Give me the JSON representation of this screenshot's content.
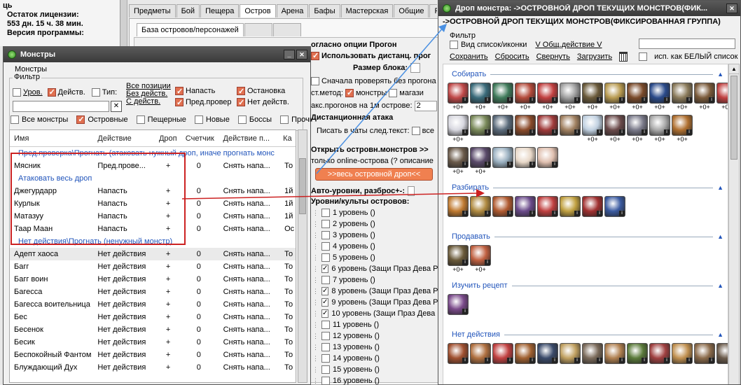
{
  "bg_window": {
    "license_label": "Остаток лицензии:",
    "license_value": "553 дн. 15 ч. 38 мин.",
    "version_label": "Версия программы:",
    "left_snippet": "ць",
    "tabs": [
      "Предметы",
      "Бой",
      "Пещера",
      "Остров",
      "Арена",
      "Бафы",
      "Мастерская",
      "Общие",
      "Раз"
    ],
    "subtab": "База островов/персонажей",
    "option_header": "огласно опции Прогон",
    "use_distant": "Использовать дистанц. прог",
    "block_size": "Размер блока:",
    "check_first": "Сначала проверять без прогона",
    "method_label": "ст.метод:",
    "method_monsters": "монстры",
    "method_magaz": "магази",
    "max_runs": "акс.прогонов на 1м острове:",
    "max_runs_value": "2",
    "distant_attack": "Дистанционная атака",
    "write_chats": "Писать в чаты след.текст:",
    "write_chats_opt": "все",
    "open_island": "Открыть островн.монстров >>",
    "online_only": "только online-острова (? описание",
    "all_drop_btn": ">>весь островной дроп<<",
    "auto_levels": "Авто-уровни, разброс+-:",
    "levels_header": "Уровни/культы островов:",
    "levels": [
      {
        "label": "1 уровень ()",
        "checked": false
      },
      {
        "label": "2 уровень ()",
        "checked": false
      },
      {
        "label": "3 уровень ()",
        "checked": false
      },
      {
        "label": "4 уровень ()",
        "checked": false
      },
      {
        "label": "5 уровень ()",
        "checked": false
      },
      {
        "label": "6 уровень (Защи Праз Дева Р",
        "checked": true
      },
      {
        "label": "7 уровень ()",
        "checked": false
      },
      {
        "label": "8 уровень (Защи Праз Дева Р",
        "checked": true
      },
      {
        "label": "9 уровень (Защи Праз Дева Р",
        "checked": true
      },
      {
        "label": "10 уровень (Защи Праз Дева Р",
        "checked": true
      },
      {
        "label": "11 уровень ()",
        "checked": false
      },
      {
        "label": "12 уровень ()",
        "checked": false
      },
      {
        "label": "13 уровень ()",
        "checked": false
      },
      {
        "label": "14 уровень ()",
        "checked": false
      },
      {
        "label": "15 уровень ()",
        "checked": false
      },
      {
        "label": "16 уровень ()",
        "checked": false
      }
    ]
  },
  "monsters_window": {
    "title": "Монстры",
    "group_monsters": "Монстры",
    "filter_label": "Фильтр",
    "chk_level": "Уров.",
    "chk_action": "Действ.",
    "chk_type": "Тип:",
    "link_all_pos": "Все позиции",
    "link_no_action": "Без действ.",
    "link_with_action": "С действ.",
    "chk_attack": "Напасть",
    "chk_precheck": "Пред.провер",
    "chk_stop": "Остановка",
    "chk_no_action": "Нет действ.",
    "clear_btn": "✕",
    "chk_all": "Все монстры",
    "chk_island": "Островные",
    "chk_cave": "Пещерные",
    "chk_new": "Новые",
    "chk_bosses": "Боссы",
    "chk_other": "Прочие",
    "columns": [
      "Имя",
      "Действие",
      "Дроп",
      "Счетчик",
      "Действие п...",
      "Ка"
    ],
    "groups": [
      {
        "title": "Пред.проверка\\Прогнать (атаковать нужный дроп, иначе прогнать монс",
        "rows": [
          [
            "Мясник",
            "Пред.прове...",
            "+",
            "0",
            "Снять напа...",
            "То"
          ]
        ]
      },
      {
        "title": "Атаковать весь дроп",
        "rows": [
          [
            "Джегурдарр",
            "Напасть",
            "+",
            "0",
            "Снять напа...",
            "1й"
          ],
          [
            "Курлык",
            "Напасть",
            "+",
            "0",
            "Снять напа...",
            "1й"
          ],
          [
            "Матазуу",
            "Напасть",
            "+",
            "0",
            "Снять напа...",
            "1й"
          ],
          [
            "Таар Маан",
            "Напасть",
            "+",
            "0",
            "Снять напа...",
            "Ос"
          ]
        ]
      },
      {
        "title": "Нет действия\\Прогнать (ненужный монстр)",
        "rows": [
          [
            "Адепт хаоса",
            "Нет действия",
            "+",
            "0",
            "Снять напа...",
            "То"
          ],
          [
            "Багг",
            "Нет действия",
            "+",
            "0",
            "Снять напа...",
            "То"
          ],
          [
            "Багг воин",
            "Нет действия",
            "+",
            "0",
            "Снять напа...",
            "То"
          ],
          [
            "Багесса",
            "Нет действия",
            "+",
            "0",
            "Снять напа...",
            "То"
          ],
          [
            "Багесса воительница",
            "Нет действия",
            "+",
            "0",
            "Снять напа...",
            "То"
          ],
          [
            "Бес",
            "Нет действия",
            "+",
            "0",
            "Снять напа...",
            "То"
          ],
          [
            "Бесенок",
            "Нет действия",
            "+",
            "0",
            "Снять напа...",
            "То"
          ],
          [
            "Бесик",
            "Нет действия",
            "+",
            "0",
            "Снять напа...",
            "То"
          ],
          [
            "Беспокойный Фантом",
            "Нет действия",
            "+",
            "0",
            "Снять напа...",
            "То"
          ],
          [
            "Блуждающий Дух",
            "Нет действия",
            "+",
            "0",
            "Снять напа...",
            "То"
          ]
        ]
      }
    ]
  },
  "drop_window": {
    "title": "Дроп монстра: ->ОСТРОВНОЙ ДРОП ТЕКУЩИХ МОНСТРОВ(ФИК...",
    "header": "->ОСТРОВНОЙ ДРОП ТЕКУЩИХ МОНСТРОВ(ФИКСИРОВАННАЯ ГРУППА)",
    "filter_label": "Фильтр",
    "view_list": "Вид список/иконки",
    "general_action": "V Общ.действие V",
    "save": "Сохранить",
    "reset": "Сбросить",
    "collapse": "Свернуть",
    "load": "Загрузить",
    "white_list": "исп. как БЕЛЫЙ список",
    "sections": [
      {
        "title": "Собирать",
        "rows": [
          {
            "colors": [
              "#c04848",
              "#3a6b7a",
              "#3f7a5a",
              "#b34a3a",
              "#c24040",
              "#a0a0a0",
              "#6a5a3a",
              "#b89a50",
              "#7a4a2a",
              "#2a4a8a",
              "#8a7a5a",
              "#7a5a3a",
              "#c04040",
              "#b48a40",
              "#d04a3a"
            ],
            "labels": [
              "+0+",
              "+0+",
              "+0+",
              "+0+",
              "+0+",
              "+0+",
              "+0+",
              "+0+",
              "+0+",
              "+0+",
              "+0+",
              "+0+",
              "+0+",
              "+0+",
              "+0+"
            ]
          },
          {
            "colors": [
              "#d8d8e0",
              "#7a8a5a",
              "#5a6a7a",
              "#8a4a2a",
              "#a03a3a",
              "#a08060",
              "#c0d0e0",
              "#6a4a4a",
              "#7a7a8a",
              "#aaaaaa",
              "#b07030"
            ],
            "labels": [
              "+0+",
              "",
              "",
              "",
              "",
              "",
              "+0+",
              "+0+",
              "+0+",
              "+0+",
              "+0+"
            ]
          },
          {
            "colors": [
              "#6a5a4a",
              "#5a4a6a",
              "#9ab0c0",
              "#e8d8c8",
              "#e0c0b0"
            ],
            "labels": [
              "+0+",
              "+0+",
              "",
              "",
              ""
            ]
          }
        ]
      },
      {
        "title": "Разбирать",
        "rows": [
          {
            "colors": [
              "#c07a30",
              "#b08a40",
              "#b05a30",
              "#6a4a8a",
              "#c04040",
              "#c0a040",
              "#a03030",
              "#3a5aa0"
            ],
            "labels": [
              "",
              "",
              "",
              "",
              "",
              "",
              "",
              ""
            ]
          }
        ]
      },
      {
        "title": "Продавать",
        "rows": [
          {
            "colors": [
              "#6a5a3a",
              "#c06040"
            ],
            "labels": [
              "+0+",
              "+0+"
            ]
          }
        ]
      },
      {
        "title": "Изучить рецепт",
        "rows": [
          {
            "colors": [
              "#7a4a8a"
            ],
            "labels": [
              ""
            ]
          }
        ]
      },
      {
        "title": "Нет действия",
        "rows": [
          {
            "colors": [
              "#a05030",
              "#b07040",
              "#c04040",
              "#a06030",
              "#3a4a6a",
              "#c0a060",
              "#7a6a5a",
              "#b08050",
              "#5a7a3a",
              "#a04040",
              "#c09050",
              "#8a6a4a",
              "#6a5a4a",
              "#c05040",
              "#a07040"
            ],
            "labels": [
              "",
              "",
              "",
              "",
              "",
              "",
              "",
              "",
              "",
              "",
              "",
              "",
              "",
              "",
              ""
            ]
          }
        ]
      }
    ]
  },
  "colors": {
    "accent_red": "#cc2222",
    "arrow_blue": "#4a90e2",
    "link_blue": "#2255bb",
    "button_orange": "#f08050"
  }
}
